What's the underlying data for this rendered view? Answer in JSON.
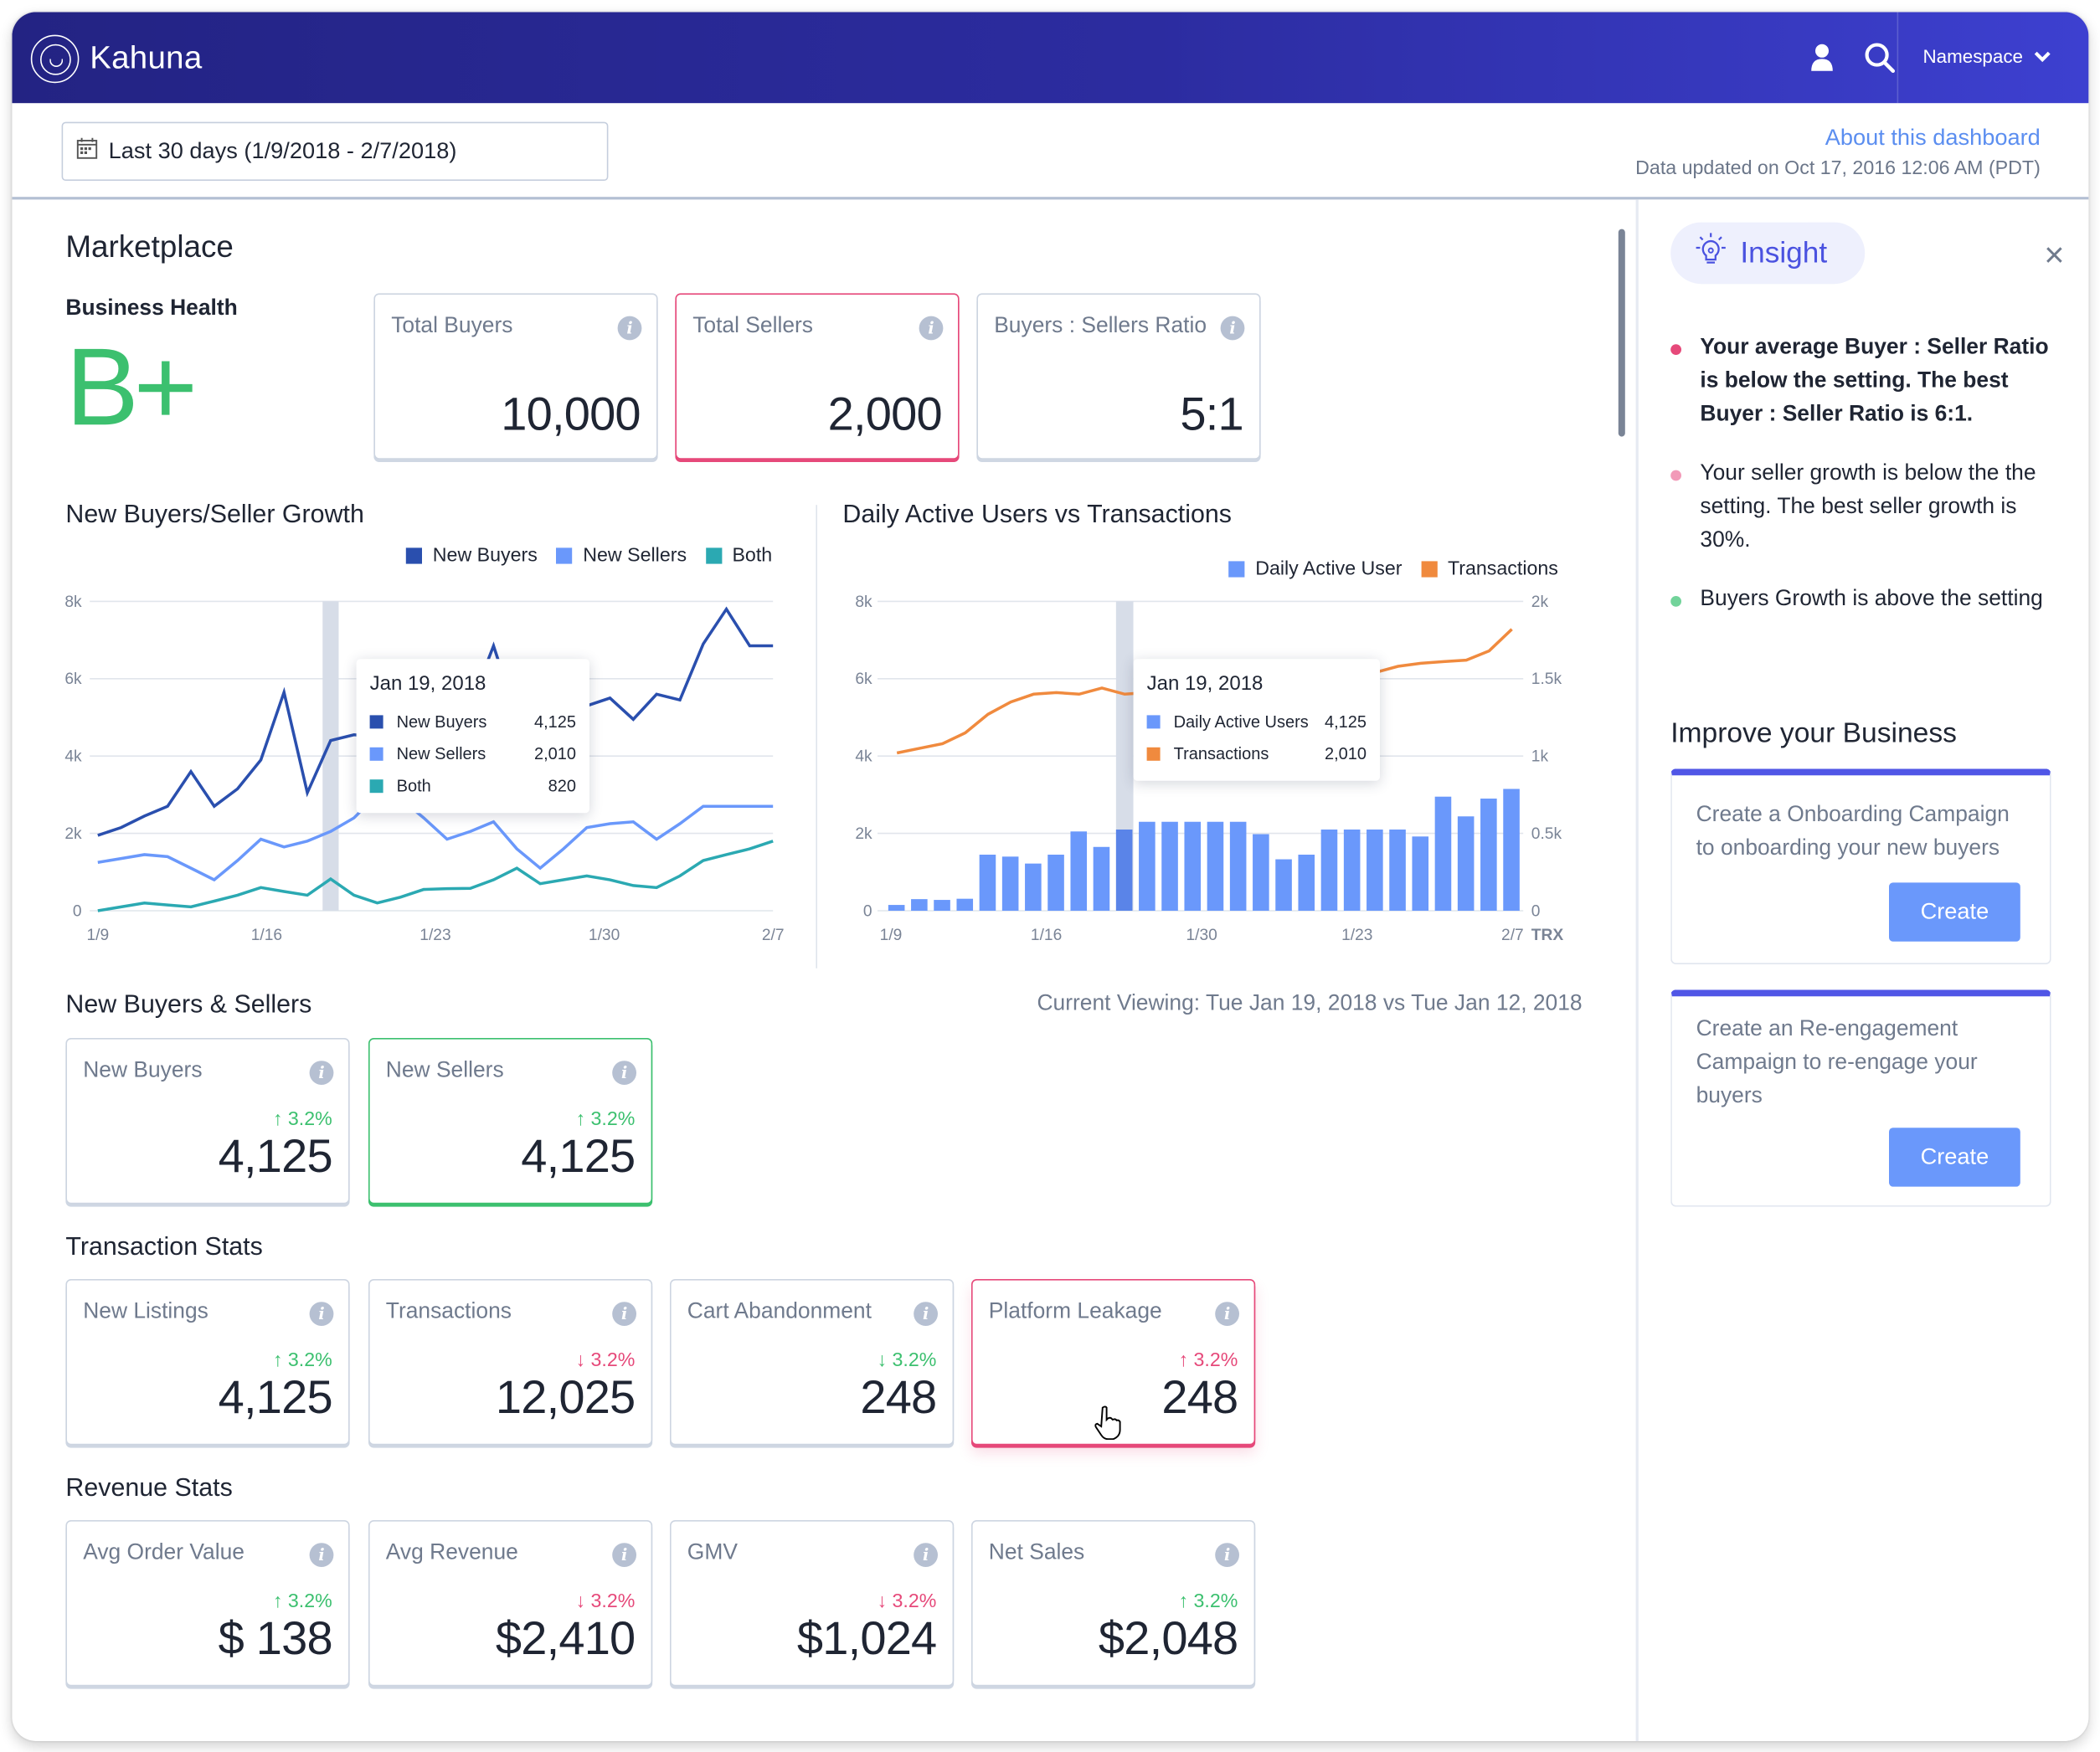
{
  "app": {
    "title": "Kahuna",
    "namespace_label": "Namespace",
    "icons": {
      "logo": "kahuna-logo-icon",
      "user": "user-icon",
      "search": "search-icon",
      "chevron": "chevron-down-icon"
    }
  },
  "toolbar": {
    "date_range": "Last 30 days (1/9/2018 - 2/7/2018)",
    "about_link": "About this dashboard",
    "updated_text": "Data updated on Oct 17, 2016 12:06 AM (PDT)"
  },
  "colors": {
    "brand_dark": "#232383",
    "brand_light": "#3d40d0",
    "accent_blue": "#5b8ef0",
    "good": "#3cc06f",
    "bad": "#e6497a",
    "new_buyers": "#2a4fae",
    "new_sellers": "#6a98fb",
    "both": "#2ba9b2",
    "dau": "#6a98fb",
    "transactions": "#f08a3e"
  },
  "marketplace": {
    "title": "Marketplace",
    "business_health": {
      "label": "Business Health",
      "grade": "B+"
    },
    "summary_cards": [
      {
        "label": "Total Buyers",
        "value": "10,000",
        "highlight": "none"
      },
      {
        "label": "Total Sellers",
        "value": "2,000",
        "highlight": "bad"
      },
      {
        "label": "Buyers : Sellers Ratio",
        "value": "5:1",
        "highlight": "none"
      }
    ]
  },
  "chart_data": [
    {
      "type": "line",
      "title": "New Buyers/Seller Growth",
      "x_ticks": [
        "1/9",
        "1/16",
        "1/23",
        "1/30",
        "2/7"
      ],
      "y_ticks": [
        "0",
        "2k",
        "4k",
        "6k",
        "8k"
      ],
      "ylim": [
        0,
        8000
      ],
      "grid": true,
      "legend_position": "top-right",
      "x": [
        "1/9",
        "1/10",
        "1/11",
        "1/12",
        "1/13",
        "1/14",
        "1/15",
        "1/16",
        "1/17",
        "1/18",
        "1/19",
        "1/20",
        "1/21",
        "1/22",
        "1/23",
        "1/24",
        "1/25",
        "1/26",
        "1/27",
        "1/28",
        "1/29",
        "1/30",
        "1/31",
        "2/1",
        "2/2",
        "2/3",
        "2/4",
        "2/5",
        "2/6",
        "2/7"
      ],
      "series": [
        {
          "name": "New Buyers",
          "values": [
            1950,
            2150,
            2450,
            2700,
            3600,
            2700,
            3150,
            3900,
            5650,
            3050,
            4400,
            4550,
            4500,
            4700,
            4800,
            5100,
            5300,
            6850,
            5000,
            4600,
            5100,
            5300,
            5500,
            4950,
            5600,
            5450,
            6900,
            7800,
            6850,
            6850
          ]
        },
        {
          "name": "New Sellers",
          "values": [
            1250,
            1350,
            1450,
            1400,
            1100,
            800,
            1300,
            1850,
            1650,
            1800,
            2050,
            2400,
            3000,
            2900,
            2400,
            1850,
            2050,
            2300,
            1600,
            1100,
            1600,
            2150,
            2250,
            2300,
            1850,
            2250,
            2700,
            2700,
            2700,
            2700
          ]
        },
        {
          "name": "Both",
          "values": [
            0,
            100,
            200,
            150,
            100,
            250,
            400,
            600,
            500,
            400,
            820,
            400,
            200,
            350,
            550,
            570,
            580,
            800,
            1100,
            700,
            800,
            900,
            800,
            650,
            600,
            900,
            1300,
            1450,
            1600,
            1800
          ]
        }
      ],
      "highlight": {
        "x": "1/19"
      },
      "tooltip": {
        "title": "Jan 19, 2018",
        "rows": [
          {
            "name": "New Buyers",
            "value": "4,125"
          },
          {
            "name": "New Sellers",
            "value": "2,010"
          },
          {
            "name": "Both",
            "value": "820"
          }
        ]
      }
    },
    {
      "type": "bar",
      "title": "Daily Active Users vs Transactions",
      "x_ticks": [
        "1/9",
        "1/16",
        "1/30",
        "1/23",
        "2/7"
      ],
      "y_ticks_left": [
        "0",
        "2k",
        "4k",
        "6k",
        "8k"
      ],
      "y_ticks_right": [
        "0",
        "0.5k",
        "1k",
        "1.5k",
        "2k"
      ],
      "right_axis_label": "TRX",
      "ylim_left": [
        0,
        8000
      ],
      "ylim_right": [
        0,
        2000
      ],
      "grid": true,
      "legend_position": "top-right",
      "series": [
        {
          "name": "Daily Active User",
          "type": "bar",
          "axis": "left",
          "values": [
            150,
            300,
            280,
            310,
            1450,
            1400,
            1220,
            1450,
            2050,
            1650,
            2100,
            2300,
            2300,
            2300,
            2300,
            2300,
            1980,
            1330,
            1450,
            2100,
            2100,
            2100,
            2100,
            1920,
            2950,
            2440,
            2900,
            3150
          ]
        },
        {
          "name": "Transactions",
          "type": "line",
          "axis": "right",
          "values": [
            1020,
            1050,
            1080,
            1150,
            1270,
            1350,
            1400,
            1410,
            1400,
            1440,
            1400,
            1410,
            1450,
            1480,
            1500,
            1520,
            1540,
            1560,
            1560,
            1590,
            1600,
            1540,
            1580,
            1600,
            1610,
            1620,
            1680,
            1820
          ]
        }
      ],
      "highlight_index": 10,
      "tooltip": {
        "title": "Jan 19, 2018",
        "rows": [
          {
            "name": "Daily Active Users",
            "value": "4,125"
          },
          {
            "name": "Transactions",
            "value": "2,010"
          }
        ]
      }
    }
  ],
  "new_buyers_sellers": {
    "title": "New Buyers & Sellers",
    "current_viewing": "Current Viewing: Tue Jan 19, 2018 vs Tue Jan 12, 2018",
    "cards": [
      {
        "label": "New Buyers",
        "delta": "3.2%",
        "direction": "up",
        "sentiment": "good",
        "value": "4,125",
        "highlight": "none"
      },
      {
        "label": "New Sellers",
        "delta": "3.2%",
        "direction": "up",
        "sentiment": "good",
        "value": "4,125",
        "highlight": "good"
      }
    ]
  },
  "transaction_stats": {
    "title": "Transaction Stats",
    "cards": [
      {
        "label": "New Listings",
        "delta": "3.2%",
        "direction": "up",
        "sentiment": "good",
        "value": "4,125",
        "highlight": "none"
      },
      {
        "label": "Transactions",
        "delta": "3.2%",
        "direction": "down",
        "sentiment": "bad",
        "value": "12,025",
        "highlight": "none"
      },
      {
        "label": "Cart Abandonment",
        "delta": "3.2%",
        "direction": "down",
        "sentiment": "good",
        "value": "248",
        "highlight": "none"
      },
      {
        "label": "Platform Leakage",
        "delta": "3.2%",
        "direction": "up",
        "sentiment": "bad",
        "value": "248",
        "highlight": "bad"
      }
    ]
  },
  "revenue_stats": {
    "title": "Revenue Stats",
    "cards": [
      {
        "label": "Avg Order Value",
        "delta": "3.2%",
        "direction": "up",
        "sentiment": "good",
        "value": "$ 138",
        "highlight": "none"
      },
      {
        "label": "Avg Revenue",
        "delta": "3.2%",
        "direction": "down",
        "sentiment": "bad",
        "value": "$2,410",
        "highlight": "none"
      },
      {
        "label": "GMV",
        "delta": "3.2%",
        "direction": "down",
        "sentiment": "bad",
        "value": "$1,024",
        "highlight": "none"
      },
      {
        "label": "Net Sales",
        "delta": "3.2%",
        "direction": "up",
        "sentiment": "good",
        "value": "$2,048",
        "highlight": "none"
      }
    ]
  },
  "insight_panel": {
    "title": "Insight",
    "close_label": "×",
    "items": [
      {
        "text": "Your average Buyer : Seller Ratio is below the setting. The best Buyer : Seller Ratio is 6:1.",
        "dot_color": "#e6497a",
        "bold": true
      },
      {
        "text": "Your seller growth is below the the setting. The best seller growth is 30%.",
        "dot_color": "#f29ab8",
        "bold": false
      },
      {
        "text": "Buyers Growth is above the setting",
        "dot_color": "#72d39a",
        "bold": false
      }
    ],
    "improve_title": "Improve your Business",
    "campaigns": [
      {
        "description": "Create a Onboarding Campaign to onboarding your new buyers",
        "button": "Create"
      },
      {
        "description": "Create an Re-engagement Campaign to re-engage your buyers",
        "button": "Create"
      }
    ]
  }
}
